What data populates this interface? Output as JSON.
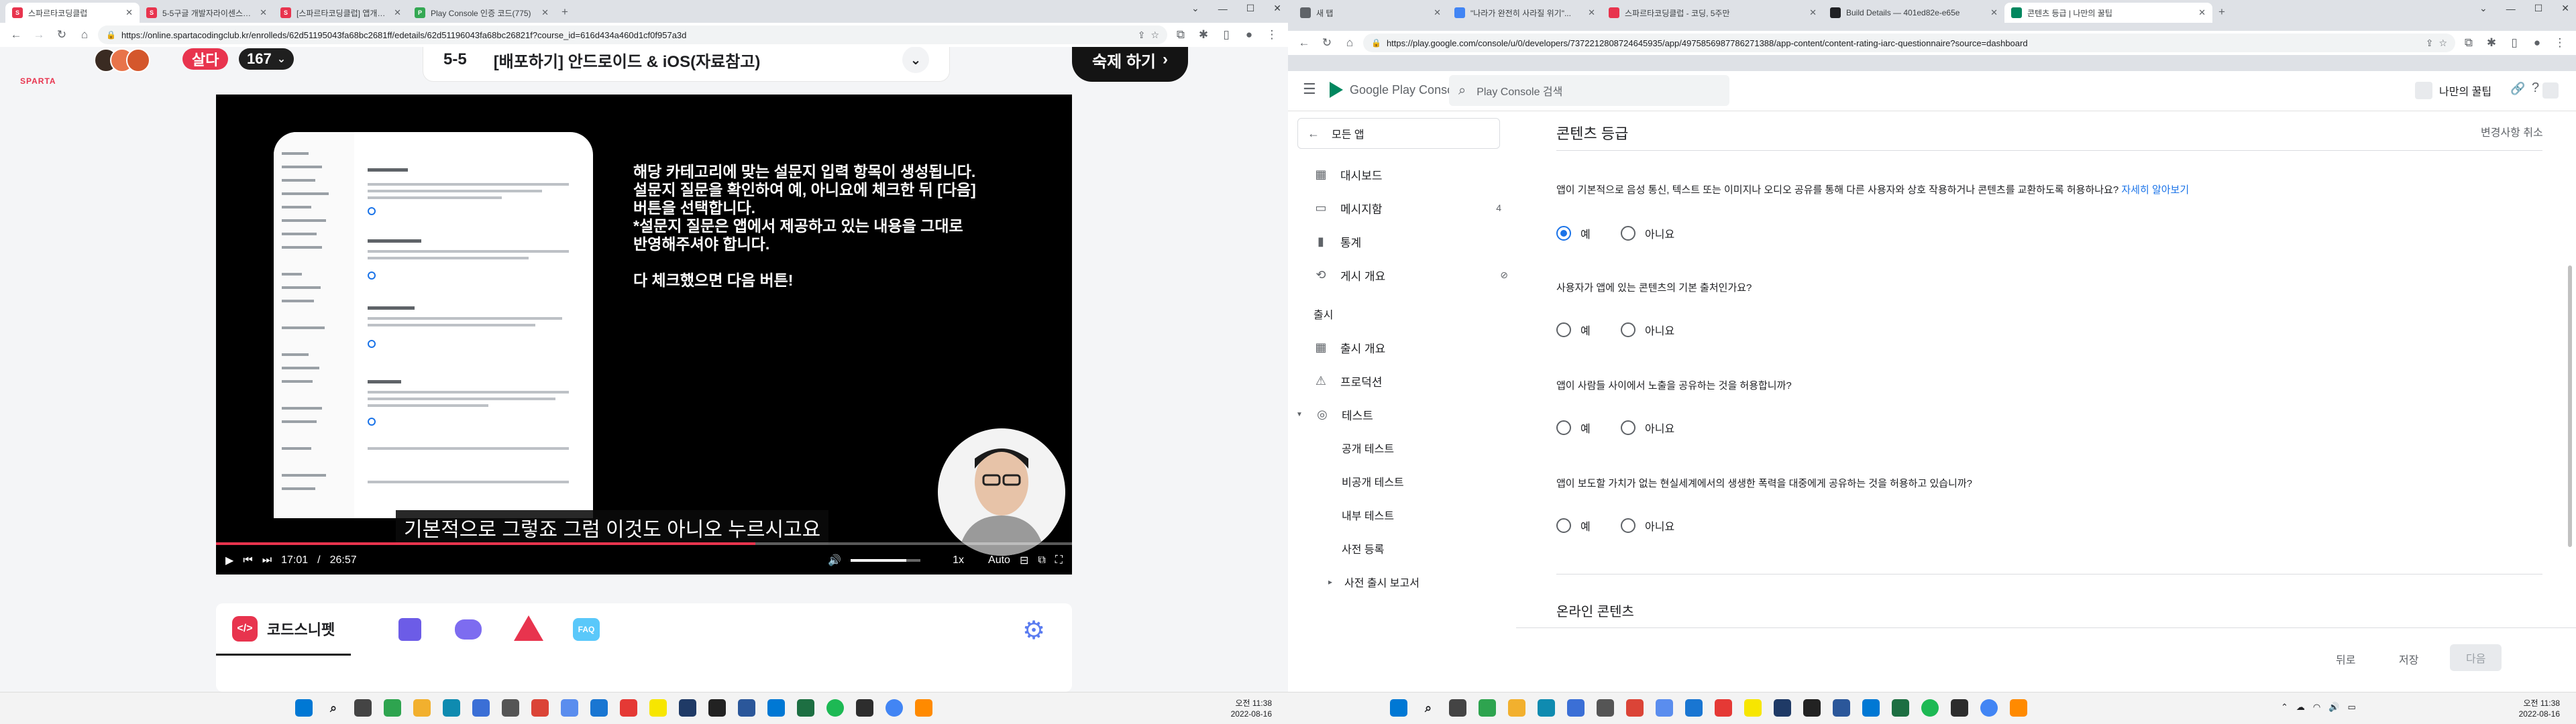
{
  "left": {
    "tabs": [
      {
        "label": "스파르타코딩클럽",
        "color": "#e8344e"
      },
      {
        "label": "5-5구글 개발자라이센스구매해",
        "color": "#e8344e"
      },
      {
        "label": "[스파르타코딩클럽] 앱개발 종합",
        "color": "#e8344e"
      },
      {
        "label": "Play Console 인증 코드(775)",
        "color": "#34a853"
      }
    ],
    "url": "https://online.spartacodingclub.kr/enrolleds/62d51195043fa68bc2681ff/edetails/62d51196043fa68bc26821f?course_id=616d434a460d1cf0f957a3d",
    "header": {
      "logo": "SPARTA",
      "badge": "살다",
      "count": "167",
      "lesson_num": "5-5",
      "lesson_title": "[배포하기] 안드로이드 & iOS(자료참고)",
      "homework_btn": "숙제 하기"
    },
    "video": {
      "caption_lines": [
        "해당 카테고리에 맞는 설문지 입력 항목이 생성됩니다.",
        "설문지 질문을 확인하여 예, 아니요에 체크한 뒤 [다음]",
        "버튼을 선택합니다.",
        "*설문지 질문은 앱에서 제공하고 있는 내용을 그대로",
        "반영해주셔야 합니다.",
        "",
        "다 체크했으면 다음 버튼!"
      ],
      "subtitle": "기본적으로 그렇죠 그럼 이것도 아니오 누르시고요",
      "time_current": "17:01",
      "time_total": "26:57",
      "time_separator": "/",
      "speed": "1x",
      "quality": "Auto",
      "progress": 0.63,
      "volume": 0.8
    },
    "snippet_tabs": [
      {
        "label": "코드스니펫",
        "icon": "code-icon"
      },
      {
        "label": "",
        "icon": "checklist-icon"
      },
      {
        "label": "",
        "icon": "chat-icon"
      },
      {
        "label": "",
        "icon": "warning-icon"
      },
      {
        "label": "FAQ",
        "icon": "faq-icon"
      }
    ],
    "clock": {
      "time": "오전 11:38",
      "date": "2022-08-16"
    }
  },
  "right": {
    "tabs": [
      {
        "label": "새 탭",
        "color": "#5f6368"
      },
      {
        "label": "\"나라가 완전히 사라질 위기\"...",
        "color": "#4285f4"
      },
      {
        "label": "스파르타코딩클럽 - 코딩, 5주만",
        "color": "#e8344e"
      },
      {
        "label": "Build Details — 401ed82e-e65e",
        "color": "#202124"
      },
      {
        "label": "콘텐츠 등급 | 나만의 꿀팁",
        "color": "#01875f"
      }
    ],
    "url": "https://play.google.com/console/u/0/developers/7372212808724645935/app/4975856987786271388/app-content/content-rating-iarc-questionnaire?source=dashboard",
    "console": {
      "brand": "Google Play Console",
      "search_placeholder": "Play Console 검색",
      "app_name": "나만의 꿀팁",
      "page_title": "콘텐츠 등급",
      "discard_link": "변경사항 취소",
      "all_apps": "모든 앱"
    },
    "nav": [
      {
        "label": "대시보드",
        "icon": "dashboard-icon",
        "count": ""
      },
      {
        "label": "메시지함",
        "icon": "inbox-icon",
        "count": "4"
      },
      {
        "label": "통계",
        "icon": "stats-icon",
        "count": ""
      },
      {
        "label": "게시 개요",
        "icon": "publishing-icon",
        "count": ""
      }
    ],
    "nav_section": "출시",
    "nav_release": [
      {
        "label": "출시 개요",
        "icon": "release-overview-icon"
      },
      {
        "label": "프로덕션",
        "icon": "production-icon"
      },
      {
        "label": "테스트",
        "icon": "testing-icon"
      }
    ],
    "nav_sub": [
      "공개 테스트",
      "비공개 테스트",
      "내부 테스트",
      "사전 등록",
      "사전 출시 보고서"
    ],
    "questions": [
      {
        "text": "앱이 기본적으로 음성 통신, 텍스트 또는 이미지나 오디오 공유를 통해 다른 사용자와 상호 작용하거나 콘텐츠를 교환하도록 허용하나요?",
        "link": "자세히 알아보기",
        "selected": "yes"
      },
      {
        "text": "사용자가 앱에 있는 콘텐츠의 기본 출처인가요?",
        "link": "",
        "selected": ""
      },
      {
        "text": "앱이 사람들 사이에서 노출을 공유하는 것을 허용합니까?",
        "link": "",
        "selected": ""
      },
      {
        "text": "앱이 보도할 가치가 없는 현실세계에서의 생생한 폭력을 대중에게 공유하는 것을 허용하고 있습니까?",
        "link": "",
        "selected": ""
      }
    ],
    "option_yes": "예",
    "option_no": "아니요",
    "section_heading": "온라인 콘텐츠",
    "footer": {
      "back": "뒤로",
      "save": "저장",
      "next": "다음"
    },
    "clock": {
      "time": "오전 11:38",
      "date": "2022-08-16"
    }
  }
}
